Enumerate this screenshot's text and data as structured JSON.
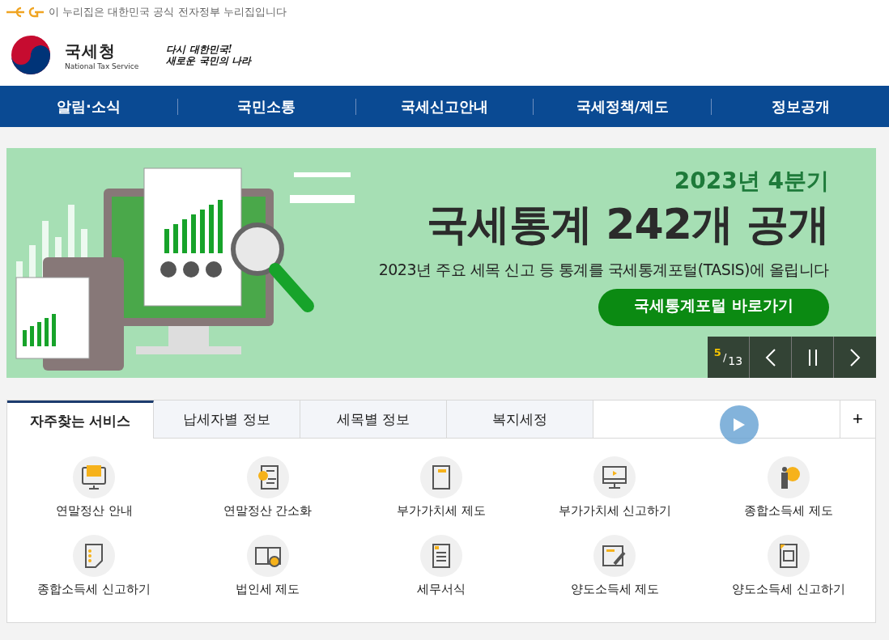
{
  "gov_notice": {
    "text": "이 누리집은 대한민국 공식 전자정부 누리집입니다"
  },
  "header": {
    "logo_name": "국세청",
    "logo_subtitle": "National Tax Service",
    "slogan_lines": [
      "다시 대한민국!",
      "새로운 국민의 나라"
    ]
  },
  "nav": {
    "items": [
      "알림·소식",
      "국민소통",
      "국세신고안내",
      "국세정책/제도",
      "정보공개"
    ]
  },
  "banner": {
    "subtitle": "2023년 4분기",
    "headline": "국세통계 242개 공개",
    "description": "2023년 주요 세목 신고 등 통계를 국세통계포털(TASIS)에 올립니다",
    "button": "국세통계포털 바로가기",
    "slide_current": "5",
    "slide_separator": "/",
    "slide_total": "13"
  },
  "services": {
    "tabs": [
      {
        "label": "자주찾는 서비스",
        "selected": true
      },
      {
        "label": "납세자별 정보",
        "selected": false
      },
      {
        "label": "세목별 정보",
        "selected": false
      },
      {
        "label": "복지세정",
        "selected": false
      }
    ],
    "more_button": "+",
    "items": [
      {
        "label": "연말정산 안내"
      },
      {
        "label": "연말정산 간소화"
      },
      {
        "label": "부가가치세 제도"
      },
      {
        "label": "부가가치세 신고하기"
      },
      {
        "label": "종합소득세 제도"
      },
      {
        "label": "종합소득세 신고하기"
      },
      {
        "label": "법인세 제도"
      },
      {
        "label": "세무서식"
      },
      {
        "label": "양도소득세 제도"
      },
      {
        "label": "양도소득세 신고하기"
      }
    ]
  }
}
